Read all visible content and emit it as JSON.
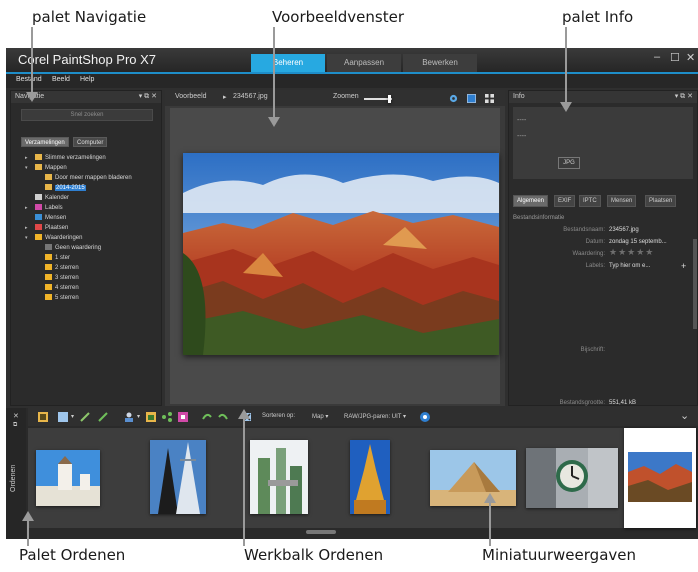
{
  "callouts": {
    "nav": "palet Navigatie",
    "preview": "Voorbeeldvenster",
    "info": "palet Info",
    "organizer": "Palet Ordenen",
    "toolbar": "Werkbalk Ordenen",
    "thumbs": "Miniatuurweergaven"
  },
  "app": {
    "title": "Corel PaintShop Pro X7",
    "tabs": [
      "Beheren",
      "Aanpassen",
      "Bewerken"
    ],
    "active_tab": "Beheren",
    "window_controls": [
      "–",
      "☐",
      "✕"
    ],
    "menu": [
      "Bestand",
      "Beeld",
      "Help"
    ]
  },
  "nav": {
    "title": "Navigatie",
    "header_controls": "▾ ⧉ ✕",
    "search_placeholder": "Snel zoeken",
    "tabs": [
      "Verzamelingen",
      "Computer"
    ],
    "tree": [
      "Slimme verzamelingen",
      "Mappen",
      "Door meer mappen bladeren",
      "2014-2015",
      "Kalender",
      "Labels",
      "Mensen",
      "Plaatsen",
      "Waarderingen",
      "Geen waardering",
      "1 ster",
      "2 sterren",
      "3 sterren",
      "4 sterren",
      "5 sterren"
    ]
  },
  "preview": {
    "label": "Voorbeeld",
    "filename": "234567.jpg",
    "zoom_label": "Zoomen"
  },
  "info": {
    "title": "Info",
    "header_controls": "▾ ⧉ ✕",
    "dash": "----",
    "format_badge": "JPG",
    "tabs": [
      "Algemeen",
      "EXIF",
      "IPTC",
      "Mensen",
      "Plaatsen"
    ],
    "section": "Bestandsinformatie",
    "fields": [
      {
        "label": "Bestandsnaam:",
        "value": "234567.jpg"
      },
      {
        "label": "Datum:",
        "value": "zondag 15 septemb..."
      },
      {
        "label": "Waardering:",
        "value": ""
      },
      {
        "label": "Labels:",
        "value": "Typ hier om e..."
      }
    ],
    "caption_label": "Bijschrift:",
    "size_label": "Bestandsgrootte:",
    "size_value": "551,41 kB",
    "add_label": "+"
  },
  "organizer": {
    "side_label": "Ordenen",
    "sort_label": "Sorteren op:",
    "sort_value": "Map ▾",
    "raw_label": "RAW/JPG-paren: UIT ▾",
    "collapse_icon": "⌄"
  },
  "colors": {
    "accent": "#27a9e1",
    "folder": "#e8b64a",
    "star": "#f0b429"
  }
}
